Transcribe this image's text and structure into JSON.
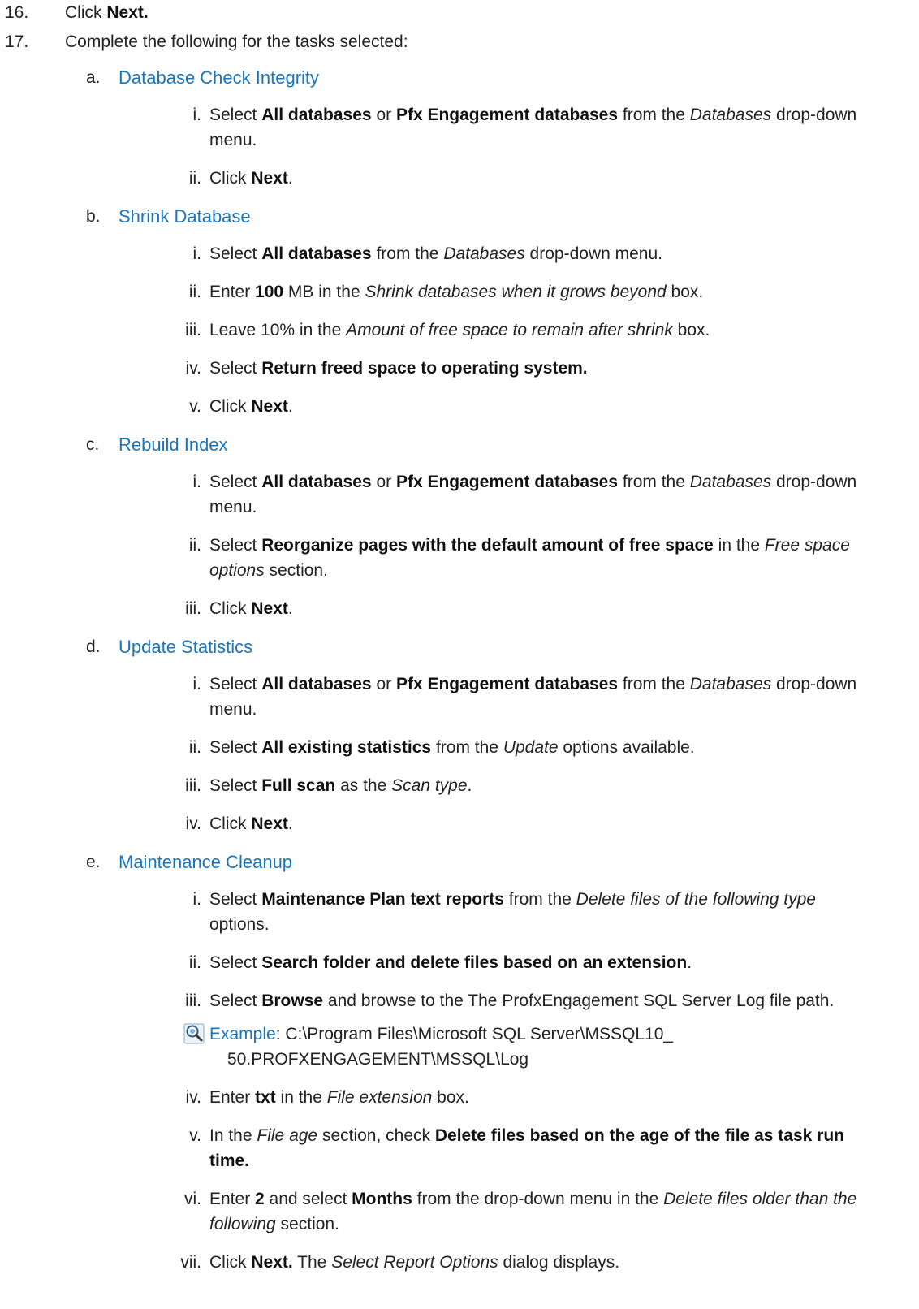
{
  "steps": [
    {
      "num": "16.",
      "pre": "Click ",
      "bold": "Next."
    },
    {
      "num": "17.",
      "text": "Complete the following for the tasks selected:"
    }
  ],
  "sections": [
    {
      "letter": "a.",
      "title": "Database Check Integrity",
      "items": [
        {
          "roman": "i.",
          "parts": [
            {
              "t": "Select "
            },
            {
              "t": "All databases",
              "b": true
            },
            {
              "t": " or "
            },
            {
              "t": "Pfx Engagement databases",
              "b": true
            },
            {
              "t": " from the "
            },
            {
              "t": "Databases",
              "i": true
            },
            {
              "t": " drop-down menu."
            }
          ]
        },
        {
          "roman": "ii.",
          "parts": [
            {
              "t": "Click "
            },
            {
              "t": "Next",
              "b": true
            },
            {
              "t": "."
            }
          ]
        }
      ]
    },
    {
      "letter": "b.",
      "title": "Shrink Database",
      "items": [
        {
          "roman": "i.",
          "parts": [
            {
              "t": "Select "
            },
            {
              "t": "All databases",
              "b": true
            },
            {
              "t": " from the "
            },
            {
              "t": "Databases",
              "i": true
            },
            {
              "t": "  drop-down menu."
            }
          ]
        },
        {
          "roman": "ii.",
          "parts": [
            {
              "t": "Enter "
            },
            {
              "t": "100",
              "b": true
            },
            {
              "t": " MB in the "
            },
            {
              "t": "Shrink databases when it grows beyond",
              "i": true
            },
            {
              "t": " box."
            }
          ]
        },
        {
          "roman": "iii.",
          "parts": [
            {
              "t": "Leave 10% in the "
            },
            {
              "t": "Amount of free space to remain after shrink",
              "i": true
            },
            {
              "t": "  box."
            }
          ]
        },
        {
          "roman": "iv.",
          "parts": [
            {
              "t": "Select "
            },
            {
              "t": "Return freed space to operating system.",
              "b": true
            }
          ]
        },
        {
          "roman": "v.",
          "parts": [
            {
              "t": "Click "
            },
            {
              "t": "Next",
              "b": true
            },
            {
              "t": "."
            }
          ]
        }
      ]
    },
    {
      "letter": "c.",
      "title": "Rebuild Index",
      "items": [
        {
          "roman": "i.",
          "parts": [
            {
              "t": "Select "
            },
            {
              "t": "All databases",
              "b": true
            },
            {
              "t": " or "
            },
            {
              "t": "Pfx Engagement databases",
              "b": true
            },
            {
              "t": " from the "
            },
            {
              "t": "Databases",
              "i": true
            },
            {
              "t": " drop-down menu."
            }
          ]
        },
        {
          "roman": "ii.",
          "parts": [
            {
              "t": "Select "
            },
            {
              "t": "Reorganize pages with the default amount of free space",
              "b": true
            },
            {
              "t": " in the "
            },
            {
              "t": "Free space options",
              "i": true
            },
            {
              "t": "  section."
            }
          ]
        },
        {
          "roman": "iii.",
          "parts": [
            {
              "t": "Click "
            },
            {
              "t": "Next",
              "b": true
            },
            {
              "t": "."
            }
          ]
        }
      ]
    },
    {
      "letter": "d.",
      "title": "Update Statistics",
      "items": [
        {
          "roman": "i.",
          "parts": [
            {
              "t": "Select "
            },
            {
              "t": "All databases",
              "b": true
            },
            {
              "t": " or "
            },
            {
              "t": "Pfx Engagement databases",
              "b": true
            },
            {
              "t": " from the "
            },
            {
              "t": "Databases",
              "i": true
            },
            {
              "t": " drop-down menu."
            }
          ]
        },
        {
          "roman": "ii.",
          "parts": [
            {
              "t": "Select "
            },
            {
              "t": "All existing statistics",
              "b": true
            },
            {
              "t": " from the "
            },
            {
              "t": "Update",
              "i": true
            },
            {
              "t": "  options available."
            }
          ]
        },
        {
          "roman": "iii.",
          "parts": [
            {
              "t": "Select "
            },
            {
              "t": "Full scan",
              "b": true
            },
            {
              "t": " as the "
            },
            {
              "t": "Scan type",
              "i": true
            },
            {
              "t": "."
            }
          ]
        },
        {
          "roman": "iv.",
          "parts": [
            {
              "t": "Click "
            },
            {
              "t": "Next",
              "b": true
            },
            {
              "t": "."
            }
          ]
        }
      ]
    },
    {
      "letter": "e.",
      "title": "Maintenance Cleanup",
      "items": [
        {
          "roman": "i.",
          "parts": [
            {
              "t": "Select "
            },
            {
              "t": "Maintenance Plan text reports",
              "b": true
            },
            {
              "t": " from the "
            },
            {
              "t": "Delete files of the following type",
              "i": true
            },
            {
              "t": "  options."
            }
          ]
        },
        {
          "roman": "ii.",
          "parts": [
            {
              "t": "Select "
            },
            {
              "t": "Search folder and delete files based on an extension",
              "b": true
            },
            {
              "t": "."
            }
          ]
        },
        {
          "roman": "iii.",
          "parts": [
            {
              "t": "Select "
            },
            {
              "t": "Browse",
              "b": true
            },
            {
              "t": " and browse to the The ProfxEngagement SQL Server Log file path."
            }
          ],
          "example": {
            "label": "Example",
            "line1": ": C:\\Program Files\\Microsoft SQL Server\\MSSQL10_",
            "line2": "50.PROFXENGAGEMENT\\MSSQL\\Log",
            "icon": "magnifier-example-icon"
          }
        },
        {
          "roman": "iv.",
          "parts": [
            {
              "t": "Enter "
            },
            {
              "t": "txt",
              "b": true
            },
            {
              "t": " in the "
            },
            {
              "t": "File extension",
              "i": true
            },
            {
              "t": "  box."
            }
          ]
        },
        {
          "roman": "v.",
          "parts": [
            {
              "t": "In the "
            },
            {
              "t": "File age",
              "i": true
            },
            {
              "t": " section, check "
            },
            {
              "t": "Delete files based on the age of the file as task run time.",
              "b": true
            }
          ]
        },
        {
          "roman": "vi.",
          "parts": [
            {
              "t": "Enter "
            },
            {
              "t": "2",
              "b": true
            },
            {
              "t": " and select "
            },
            {
              "t": "Months",
              "b": true
            },
            {
              "t": " from the drop-down menu in the "
            },
            {
              "t": "Delete files older than the following",
              "i": true
            },
            {
              "t": " section."
            }
          ]
        },
        {
          "roman": "vii.",
          "parts": [
            {
              "t": "Click "
            },
            {
              "t": "Next.",
              "b": true
            },
            {
              "t": " The "
            },
            {
              "t": "Select Report Options",
              "i": true
            },
            {
              "t": "  dialog displays."
            }
          ]
        }
      ]
    }
  ],
  "colors": {
    "heading": "#1b75bb",
    "text": "#222222"
  }
}
